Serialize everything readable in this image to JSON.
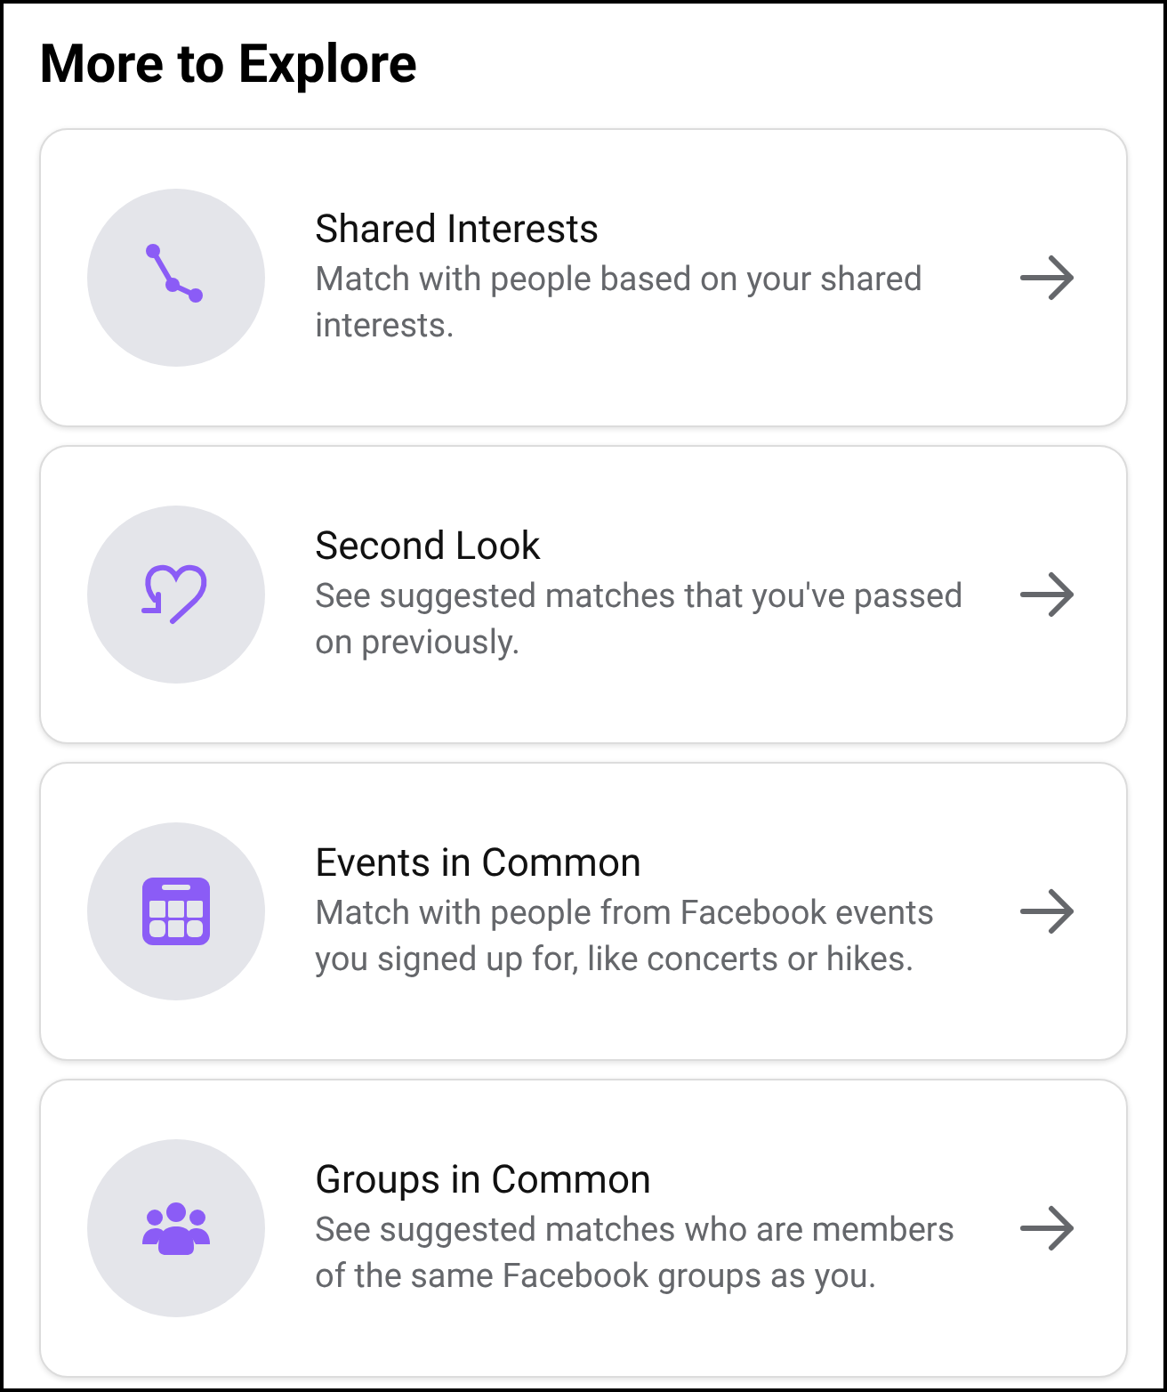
{
  "title": "More to Explore",
  "items": [
    {
      "kind": "path",
      "title": "Shared Interests",
      "description": "Match with people based on your shared interests."
    },
    {
      "kind": "heart",
      "title": "Second Look",
      "description": "See suggested matches that you've passed on previously."
    },
    {
      "kind": "calendar",
      "title": "Events in Common",
      "description": "Match with people from Facebook events you signed up for, like concerts or hikes."
    },
    {
      "kind": "people",
      "title": "Groups in Common",
      "description": "See suggested matches who are members of the same Facebook groups as you."
    }
  ]
}
